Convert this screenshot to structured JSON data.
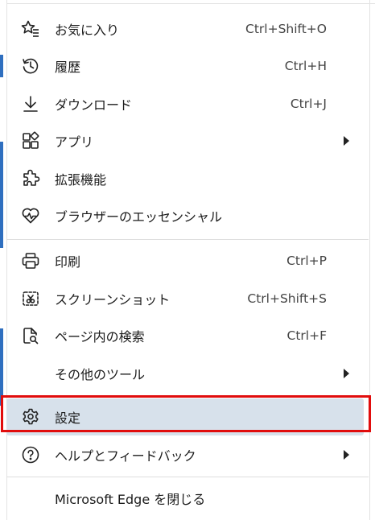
{
  "menu": {
    "items": [
      {
        "label": "お気に入り",
        "shortcut": "Ctrl+Shift+O",
        "icon": "favorites-star-icon",
        "submenu": false
      },
      {
        "label": "履歴",
        "shortcut": "Ctrl+H",
        "icon": "history-icon",
        "submenu": false
      },
      {
        "label": "ダウンロード",
        "shortcut": "Ctrl+J",
        "icon": "download-icon",
        "submenu": false
      },
      {
        "label": "アプリ",
        "shortcut": "",
        "icon": "apps-icon",
        "submenu": true
      },
      {
        "label": "拡張機能",
        "shortcut": "",
        "icon": "extensions-icon",
        "submenu": false
      },
      {
        "label": "ブラウザーのエッセンシャル",
        "shortcut": "",
        "icon": "browser-essentials-icon",
        "submenu": false
      },
      {
        "label": "印刷",
        "shortcut": "Ctrl+P",
        "icon": "print-icon",
        "submenu": false
      },
      {
        "label": "スクリーンショット",
        "shortcut": "Ctrl+Shift+S",
        "icon": "screenshot-icon",
        "submenu": false
      },
      {
        "label": "ページ内の検索",
        "shortcut": "Ctrl+F",
        "icon": "find-on-page-icon",
        "submenu": false
      },
      {
        "label": "その他のツール",
        "shortcut": "",
        "icon": "",
        "submenu": true
      },
      {
        "label": "設定",
        "shortcut": "",
        "icon": "settings-gear-icon",
        "submenu": false,
        "selected": true
      },
      {
        "label": "ヘルプとフィードバック",
        "shortcut": "",
        "icon": "help-icon",
        "submenu": true
      },
      {
        "label": "Microsoft Edge を閉じる",
        "shortcut": "",
        "icon": "",
        "submenu": false
      }
    ]
  },
  "colors": {
    "selected_background": "#d7e1eb",
    "highlight_border": "#e10d0d",
    "accent": "#2f6fbf"
  }
}
